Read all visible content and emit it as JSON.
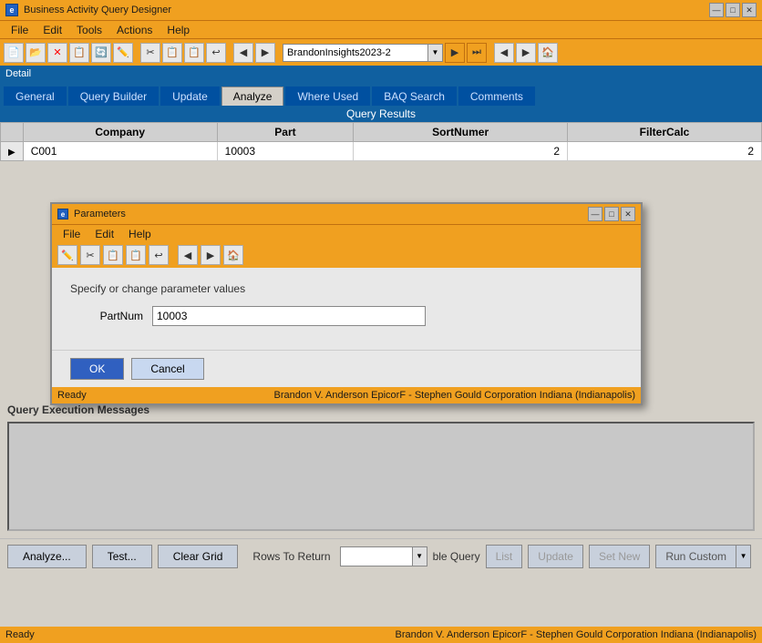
{
  "app": {
    "title": "Business Activity Query Designer",
    "icon": "e"
  },
  "title_controls": {
    "minimize": "—",
    "restore": "□",
    "close": "✕"
  },
  "menu": {
    "items": [
      "File",
      "Edit",
      "Tools",
      "Actions",
      "Help"
    ]
  },
  "toolbar": {
    "dropdown_value": "BrandonInsights2023-2"
  },
  "detail_label": "Detail",
  "tabs": [
    {
      "label": "General",
      "active": false
    },
    {
      "label": "Query Builder",
      "active": false
    },
    {
      "label": "Update",
      "active": false
    },
    {
      "label": "Analyze",
      "active": true
    },
    {
      "label": "Where Used",
      "active": false
    },
    {
      "label": "BAQ Search",
      "active": false
    },
    {
      "label": "Comments",
      "active": false
    }
  ],
  "query_results": {
    "section_label": "Query Results",
    "columns": [
      "Company",
      "Part",
      "SortNumer",
      "FilterCalc"
    ],
    "rows": [
      {
        "company": "C001",
        "part": "10003",
        "sort_numer": "2",
        "filter_calc": "2"
      }
    ]
  },
  "parameters_modal": {
    "title": "Parameters",
    "icon": "e",
    "menu_items": [
      "File",
      "Edit",
      "Help"
    ],
    "description": "Specify or change parameter values",
    "fields": [
      {
        "label": "PartNum",
        "value": "10003"
      }
    ],
    "buttons": [
      "OK",
      "Cancel"
    ],
    "status": {
      "ready": "Ready",
      "info": "Brandon V. Anderson  EpicorF - Stephen Gould Corporation  Indiana (Indianapolis)"
    }
  },
  "query_execution": {
    "label": "Query Execution Messages"
  },
  "bottom_toolbar": {
    "analyze_btn": "Analyze...",
    "test_btn": "Test...",
    "clear_grid_btn": "Clear Grid",
    "rows_label": "Rows To Return",
    "able_query_label": "ble Query",
    "list_btn": "List",
    "update_btn": "Update",
    "set_new_btn": "Set New",
    "run_custom_btn": "Run Custom"
  },
  "status_bar": {
    "ready": "Ready",
    "info": "Brandon V. Anderson  EpicorF - Stephen Gould Corporation  Indiana (Indianapolis)"
  }
}
